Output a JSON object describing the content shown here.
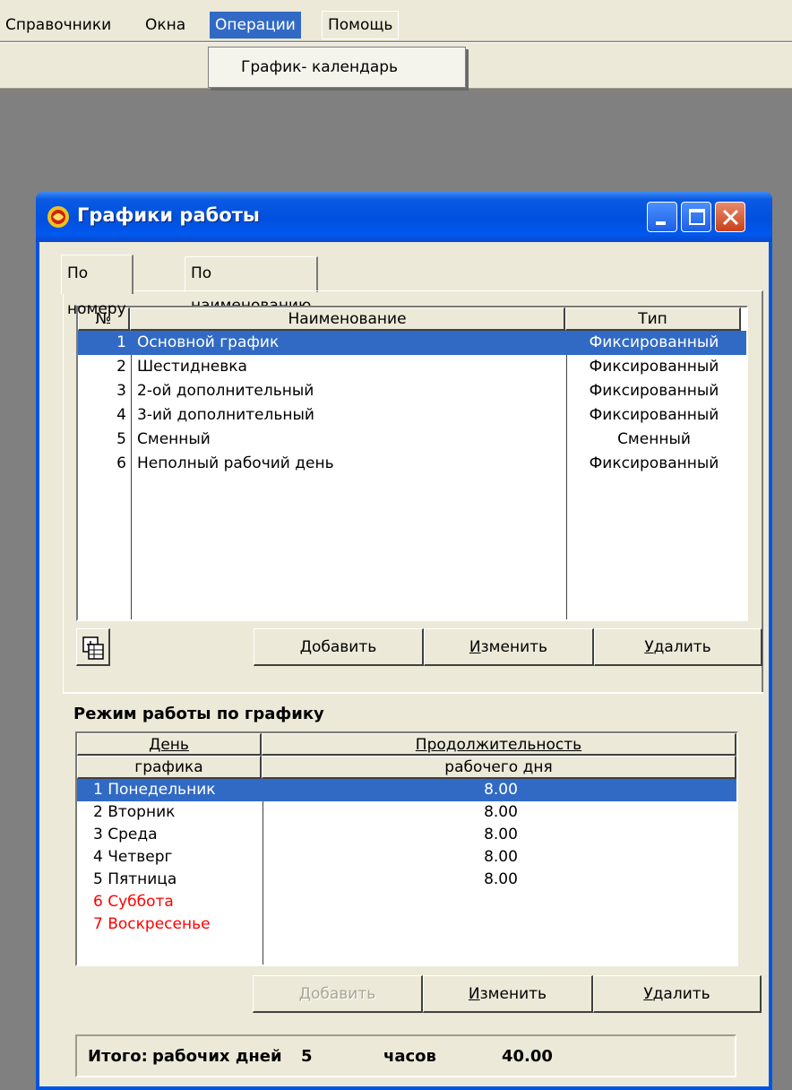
{
  "menu": {
    "items": [
      "Справочники",
      "Окна",
      "Операции",
      "Помощь"
    ],
    "dropdown_item": "График- календарь"
  },
  "window": {
    "title": "Графики работы",
    "tabs": [
      "По номеру",
      "По наименованию"
    ],
    "schedules": {
      "headers": [
        "№",
        "Наименование",
        "Тип"
      ],
      "rows": [
        {
          "num": "1",
          "name": "Основной график",
          "type": "Фиксированный"
        },
        {
          "num": "2",
          "name": "Шестидневка",
          "type": "Фиксированный"
        },
        {
          "num": "3",
          "name": "2-ой дополнительный",
          "type": "Фиксированный"
        },
        {
          "num": "4",
          "name": "3-ий дополнительный",
          "type": "Фиксированный"
        },
        {
          "num": "5",
          "name": "Сменный",
          "type": "Сменный"
        },
        {
          "num": "6",
          "name": "Неполный рабочий день",
          "type": "Фиксированный"
        }
      ],
      "selected_index": 0
    },
    "buttons_top": {
      "add_u": "Д",
      "add_rest": "обавить",
      "edit_u": "И",
      "edit_rest": "зменить",
      "delete_u": "У",
      "delete_rest": "далить"
    },
    "mode": {
      "title": "Режим работы по графику",
      "header_day_1": "День",
      "header_day_2": "графика",
      "header_dur_1": "Продолжительность",
      "header_dur_2": "рабочего дня",
      "rows": [
        {
          "day": "1 Понедельник",
          "hours": "8.00",
          "weekend": false
        },
        {
          "day": "2 Вторник",
          "hours": "8.00",
          "weekend": false
        },
        {
          "day": "3 Среда",
          "hours": "8.00",
          "weekend": false
        },
        {
          "day": "4 Четверг",
          "hours": "8.00",
          "weekend": false
        },
        {
          "day": "5 Пятница",
          "hours": "8.00",
          "weekend": false
        },
        {
          "day": "6 Суббота",
          "hours": "",
          "weekend": true
        },
        {
          "day": "7 Воскресенье",
          "hours": "",
          "weekend": true
        }
      ],
      "weekend_color": "#ff0000",
      "selected_index": 0
    },
    "buttons_bottom": {
      "add": "Добавить",
      "edit_u": "И",
      "edit_rest": "зменить",
      "delete_u": "У",
      "delete_rest": "далить"
    },
    "totals": {
      "label": "Итого:",
      "days_label": "рабочих дней",
      "days_value": "5",
      "hours_label": "часов",
      "hours_value": "40.00"
    }
  },
  "colors": {
    "selection": "#316ac5",
    "titlebar": "#0054e3",
    "face": "#ece9d8"
  }
}
